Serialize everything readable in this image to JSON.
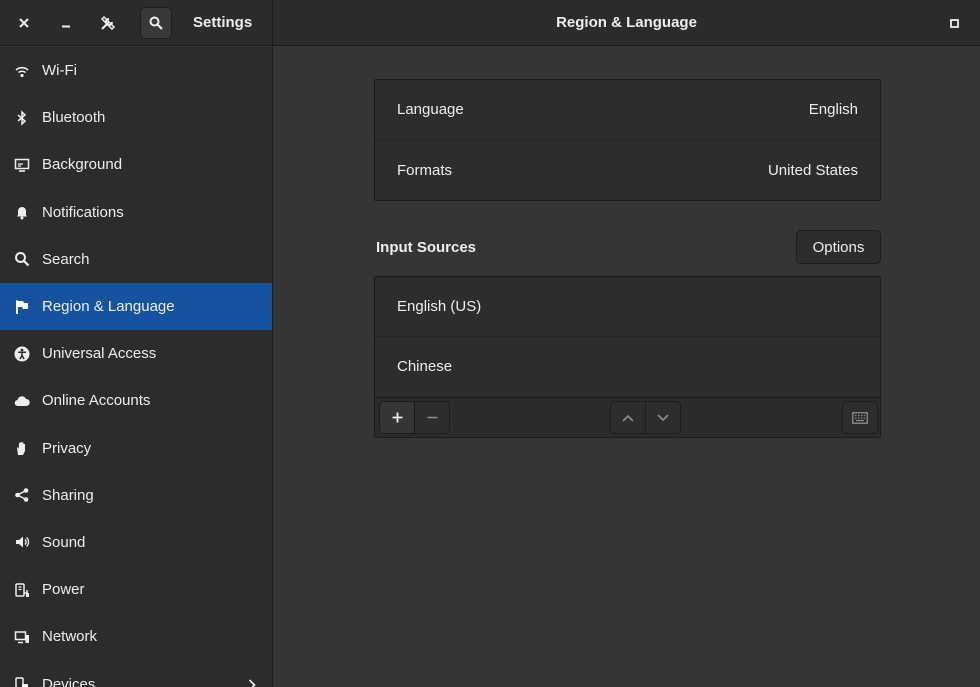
{
  "window": {
    "app_title": "Settings",
    "page_title": "Region & Language"
  },
  "header": {
    "close_icon": "close-icon",
    "minimize_icon": "minimize-icon",
    "tools_icon": "tools-icon",
    "search_icon": "search-icon",
    "maximize_icon": "maximize-icon"
  },
  "sidebar": {
    "items": [
      {
        "label": "Wi-Fi",
        "icon": "wifi-icon"
      },
      {
        "label": "Bluetooth",
        "icon": "bluetooth-icon"
      },
      {
        "label": "Background",
        "icon": "background-icon"
      },
      {
        "label": "Notifications",
        "icon": "bell-icon"
      },
      {
        "label": "Search",
        "icon": "search-icon"
      },
      {
        "label": "Region & Language",
        "icon": "flag-icon",
        "active": true
      },
      {
        "label": "Universal Access",
        "icon": "accessibility-icon"
      },
      {
        "label": "Online Accounts",
        "icon": "cloud-icon"
      },
      {
        "label": "Privacy",
        "icon": "hand-icon"
      },
      {
        "label": "Sharing",
        "icon": "share-icon"
      },
      {
        "label": "Sound",
        "icon": "speaker-icon"
      },
      {
        "label": "Power",
        "icon": "power-icon"
      },
      {
        "label": "Network",
        "icon": "network-icon"
      },
      {
        "label": "Devices",
        "icon": "devices-icon",
        "has_submenu": true
      }
    ]
  },
  "region": {
    "language_label": "Language",
    "language_value": "English",
    "formats_label": "Formats",
    "formats_value": "United States"
  },
  "input_sources": {
    "title": "Input Sources",
    "options_label": "Options",
    "items": [
      "English (US)",
      "Chinese"
    ],
    "toolbar": {
      "add_label": "+",
      "remove_label": "−"
    }
  },
  "colors": {
    "accent": "#15539e",
    "background": "#353535",
    "sidebar": "#2c2c2c",
    "text": "#eeeeec"
  }
}
